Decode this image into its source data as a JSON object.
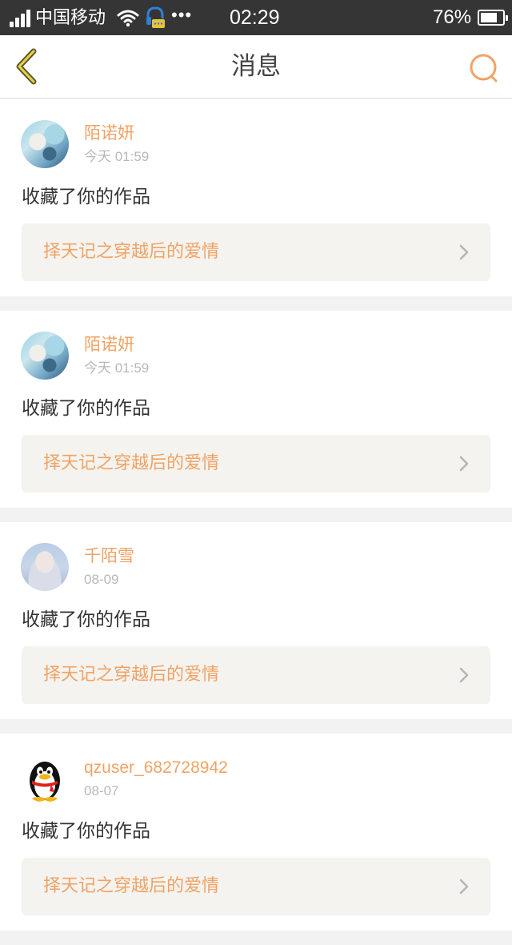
{
  "status_bar": {
    "carrier": "中国移动",
    "dots": "•••",
    "time": "02:29",
    "battery_percent": "76%",
    "battery_level": 0.76
  },
  "nav": {
    "title": "消息",
    "accent_color": "#f0a366"
  },
  "messages": [
    {
      "username": "陌诺妍",
      "time": "今天 01:59",
      "action": "收藏了你的作品",
      "work_title": "择天记之穿越后的爱情",
      "avatar": "anime-girl-avatar"
    },
    {
      "username": "陌诺妍",
      "time": "今天 01:59",
      "action": "收藏了你的作品",
      "work_title": "择天记之穿越后的爱情",
      "avatar": "anime-girl-avatar"
    },
    {
      "username": "千陌雪",
      "time": "08-09",
      "action": "收藏了你的作品",
      "work_title": "择天记之穿越后的爱情",
      "avatar": "girl-photo-avatar"
    },
    {
      "username": "qzuser_682728942",
      "time": "08-07",
      "action": "收藏了你的作品",
      "work_title": "择天记之穿越后的爱情",
      "avatar": "qq-penguin-avatar"
    }
  ]
}
